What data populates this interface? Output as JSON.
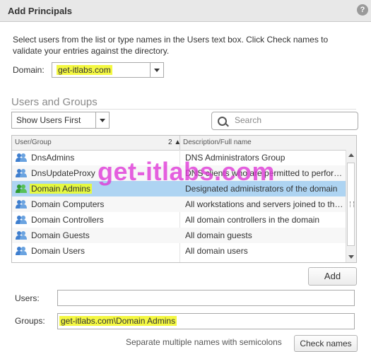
{
  "dialog": {
    "title": "Add Principals",
    "help_icon": "question-icon"
  },
  "instructions": "Select users from the list or type names in the Users text box. Click Check names to validate your entries against the directory.",
  "domain": {
    "label": "Domain:",
    "value": "get-itlabs.com"
  },
  "users_groups": {
    "title": "Users and Groups",
    "filter": {
      "selected": "Show Users First"
    },
    "search": {
      "placeholder": "Search"
    },
    "columns": {
      "name": "User/Group",
      "sort_indicator": "2 ▲",
      "description": "Description/Full name"
    },
    "rows": [
      {
        "name": "DnsAdmins",
        "description": "DNS Administrators Group",
        "icon": "group-icon"
      },
      {
        "name": "DnsUpdateProxy",
        "description": "DNS clients who are permitted to perform dynamic updates",
        "icon": "group-icon"
      },
      {
        "name": "Domain Admins",
        "description": "Designated administrators of the domain",
        "icon": "group-icon",
        "selected": true
      },
      {
        "name": "Domain Computers",
        "description": "All workstations and servers joined to the domain",
        "icon": "group-icon"
      },
      {
        "name": "Domain Controllers",
        "description": "All domain controllers in the domain",
        "icon": "group-icon"
      },
      {
        "name": "Domain Guests",
        "description": "All domain guests",
        "icon": "group-icon"
      },
      {
        "name": "Domain Users",
        "description": "All domain users",
        "icon": "group-icon"
      }
    ]
  },
  "add_button": "Add",
  "users_field": {
    "label": "Users:",
    "value": ""
  },
  "groups_field": {
    "label": "Groups:",
    "value": "get-itlabs.com\\Domain Admins"
  },
  "hint": "Separate multiple names with semicolons",
  "check_names_button": "Check names",
  "watermark": "get-itlabs.com",
  "colors": {
    "selection": "#aed4f2",
    "highlight": "#f4f842",
    "watermark": "#e03ad8"
  }
}
